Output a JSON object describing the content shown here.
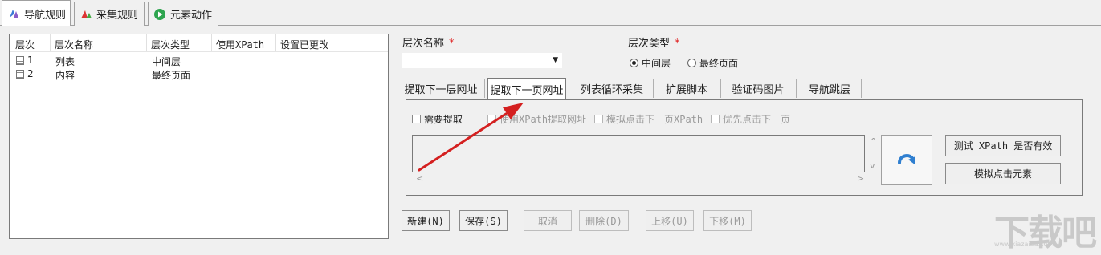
{
  "top_tabs": [
    {
      "label": "导航规则",
      "icon": "nav-rules-icon",
      "active": true
    },
    {
      "label": "采集规则",
      "icon": "collect-rules-icon",
      "active": false
    },
    {
      "label": "元素动作",
      "icon": "play-icon",
      "active": false
    }
  ],
  "level_table": {
    "headers": [
      "层次",
      "层次名称",
      "层次类型",
      "使用XPath",
      "设置已更改"
    ],
    "rows": [
      {
        "level": "1",
        "name": "列表",
        "type": "中间层"
      },
      {
        "level": "2",
        "name": "内容",
        "type": "最终页面"
      }
    ]
  },
  "form": {
    "level_name_label": "层次名称",
    "level_type_label": "层次类型",
    "required_mark": "*",
    "level_name_value": "",
    "type_options": [
      {
        "label": "中间层",
        "selected": true
      },
      {
        "label": "最终页面",
        "selected": false
      }
    ]
  },
  "inner_tabs": [
    {
      "label": "提取下一层网址",
      "active": false
    },
    {
      "label": "提取下一页网址",
      "active": true
    },
    {
      "label": "列表循环采集",
      "active": false
    },
    {
      "label": "扩展脚本",
      "active": false
    },
    {
      "label": "验证码图片",
      "active": false
    },
    {
      "label": "导航跳层",
      "active": false
    }
  ],
  "panel": {
    "checkboxes": [
      {
        "label": "需要提取",
        "enabled": true,
        "checked": false
      },
      {
        "label": "使用XPath提取网址",
        "enabled": false,
        "checked": false
      },
      {
        "label": "模拟点击下一页XPath",
        "enabled": false,
        "checked": false
      },
      {
        "label": "优先点击下一页",
        "enabled": false,
        "checked": false
      }
    ],
    "xpath_text": "",
    "test_xpath_label": "测试 XPath 是否有效",
    "simulate_click_label": "模拟点击元素",
    "scroll_up": "^",
    "scroll_down": "v",
    "scroll_left": "<",
    "scroll_right": ">"
  },
  "bottom_buttons": [
    {
      "label": "新建(N)",
      "enabled": true
    },
    {
      "label": "保存(S)",
      "enabled": true
    },
    {
      "label": "取消",
      "enabled": false
    },
    {
      "label": "删除(D)",
      "enabled": false
    },
    {
      "label": "上移(U)",
      "enabled": false
    },
    {
      "label": "下移(M)",
      "enabled": false
    }
  ],
  "watermark": {
    "text": "下载吧",
    "sub": "www.xiazaiba.com"
  },
  "colors": {
    "required": "#e02020",
    "annotation_arrow": "#d42020",
    "icon_blue": "#2f7fd0"
  }
}
